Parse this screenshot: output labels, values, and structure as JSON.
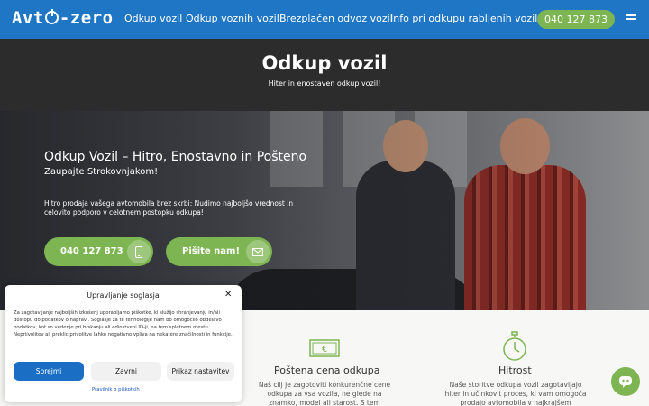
{
  "nav": {
    "logo_left": "Avt",
    "logo_right": "-zero",
    "links": [
      "Odkup vozil",
      "Odkup voznih vozil",
      "Brezplačen odvoz vozil",
      "Info pri odkupu rabljenih vozil"
    ],
    "phone": "040 127 873",
    "menu_icon": "hamburger-icon"
  },
  "title_band": {
    "title": "Odkup vozil",
    "subtitle": "Hiter in enostaven odkup vozil!"
  },
  "hero": {
    "heading": "Odkup Vozil – Hitro, Enostavno in Pošteno",
    "subheading": "Zaupajte Strokovnjakom!",
    "paragraph": "Hitro prodaja vašega avtomobila brez skrbi: Nudimo najboljšo vrednost in celovito podporo v celotnem postopku odkupa!",
    "cta_phone": "040 127 873",
    "cta_phone_icon": "phone-icon",
    "cta_write": "Pišite nam!",
    "cta_write_icon": "envelope-icon"
  },
  "features": [
    {
      "icon": "money-icon",
      "title": "Poštena cena odkupa",
      "text": "Naš cilj je zagotoviti konkurenčne cene odkupa za vsa vozila, ne glede na znamko, model ali starost. S tem"
    },
    {
      "icon": "stopwatch-icon",
      "title": "Hitrost",
      "text": "Naše storitve odkupa vozil zagotavljajo hiter in učinkovit proces, ki vam omogoča prodajo avtomobila v najkrajšem"
    }
  ],
  "cookie": {
    "title": "Upravljanje soglasja",
    "body": "Za zagotavljanje najboljših izkušenj uporabljamo piškotke, ki služijo shranjevanju in/ali dostopu do podatkov o napravi. Soglasje za te tehnologije nam bo omogočilo obdelavo podatkov, kot so vedenje pri brskanju ali edinstveni ID-ji, na tem spletnem mestu. Nepriivolitev ali preklic privolitve lahko negativno vpliva na nekatere značilnosti in funkcije.",
    "accept": "Sprejmi",
    "reject": "Zavrni",
    "preferences": "Prikaz nastavitev",
    "policy_link": "Pravilnik o piškotkih",
    "close_icon": "close-icon"
  },
  "colors": {
    "nav_blue": "#1f76c4",
    "accent_green": "#7db552",
    "dark_band": "#2c2c2c",
    "cookie_accept_blue": "#1a6fc4"
  }
}
